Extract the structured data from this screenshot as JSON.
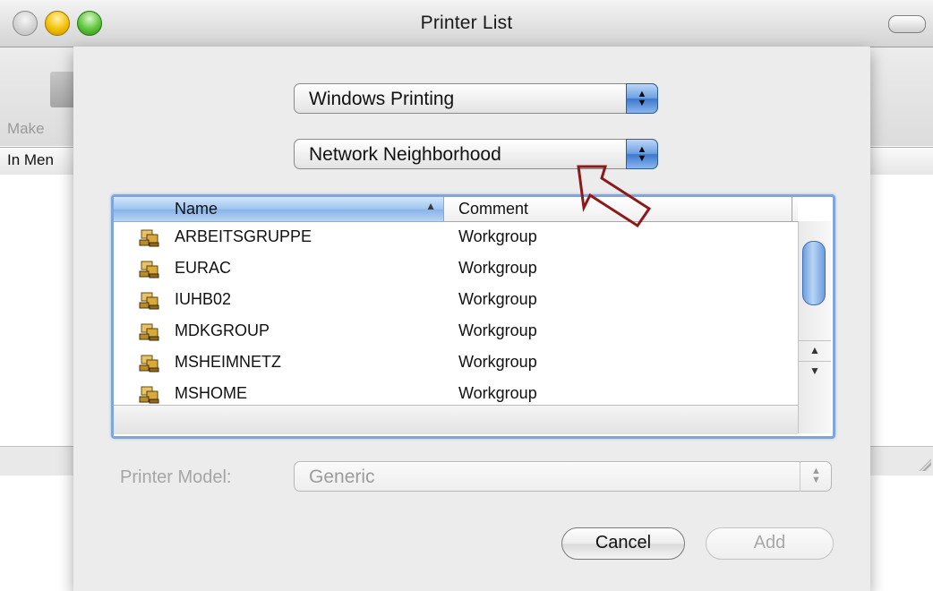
{
  "window": {
    "title": "Printer List",
    "toolbar_label": "Make",
    "column_header": "In Men"
  },
  "sheet": {
    "protocol_popup": {
      "selected": "Windows Printing"
    },
    "location_popup": {
      "selected": "Network Neighborhood"
    },
    "table": {
      "columns": {
        "name": "Name",
        "comment": "Comment"
      },
      "sort_indicator": "▲",
      "rows": [
        {
          "name": "ARBEITSGRUPPE",
          "comment": "Workgroup"
        },
        {
          "name": "EURAC",
          "comment": "Workgroup"
        },
        {
          "name": "IUHB02",
          "comment": "Workgroup"
        },
        {
          "name": "MDKGROUP",
          "comment": "Workgroup"
        },
        {
          "name": "MSHEIMNETZ",
          "comment": "Workgroup"
        },
        {
          "name": "MSHOME",
          "comment": "Workgroup"
        }
      ]
    },
    "printer_model": {
      "label": "Printer Model:",
      "selected": "Generic"
    },
    "buttons": {
      "cancel": "Cancel",
      "add": "Add"
    }
  },
  "colors": {
    "annotation_arrow": "#8b1a1a",
    "selection_blue": "#7fa6dc"
  },
  "icons": {
    "workgroup": "workgroup-icon",
    "popup_arrows": "updown-arrows-icon"
  }
}
